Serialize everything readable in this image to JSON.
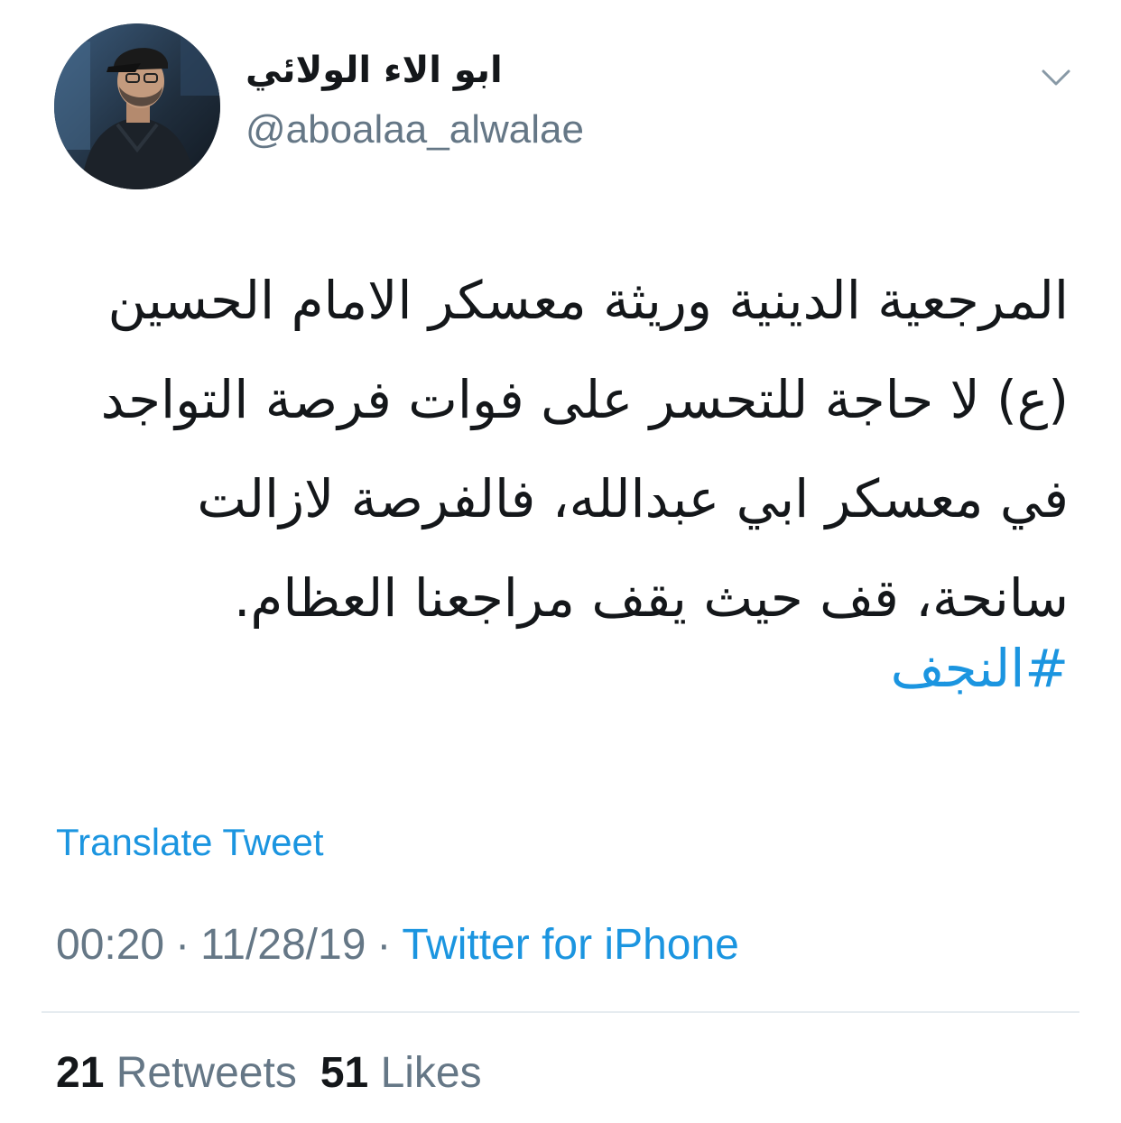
{
  "user": {
    "display_name": "ابو الاء الولائي",
    "handle": "@aboalaa_alwalae",
    "avatar_icon": "profile-photo"
  },
  "menu": {
    "icon": "chevron-down-icon",
    "color": "#8899a6"
  },
  "tweet": {
    "lines": [
      "المرجعية الدينية وريثة معسكر الامام الحسين",
      "(ع) لا حاجة للتحسر على فوات فرصة التواجد",
      "في معسكر ابي عبدالله، فالفرصة لازالت",
      "سانحة، قف حيث يقف مراجعنا العظام."
    ],
    "hashtag": "#النجف"
  },
  "translate_label": "Translate Tweet",
  "meta": {
    "time": "00:20",
    "separator": "·",
    "date": "11/28/19",
    "source": "Twitter for iPhone"
  },
  "stats": {
    "retweets_count": "21",
    "retweets_label": "Retweets",
    "likes_count": "51",
    "likes_label": "Likes"
  },
  "colors": {
    "text": "#14171a",
    "secondary": "#657786",
    "link": "#1b95e0",
    "divider": "#e6ecf0"
  }
}
